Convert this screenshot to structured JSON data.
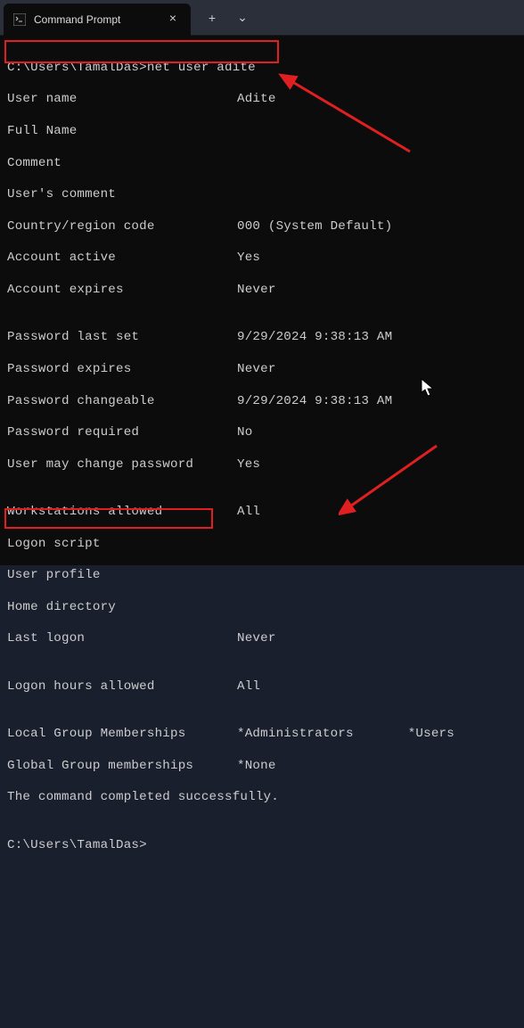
{
  "tab": {
    "title": "Command Prompt",
    "close_glyph": "×",
    "new_glyph": "+",
    "dropdown_glyph": "⌄"
  },
  "prompt_line": "C:\\Users\\TamalDas>net user adite",
  "blank": "",
  "info": {
    "user_name_l": "User name",
    "user_name_v": "Adite",
    "full_name_l": "Full Name",
    "full_name_v": "",
    "comment_l": "Comment",
    "comment_v": "",
    "users_comment_l": "User's comment",
    "users_comment_v": "",
    "country_l": "Country/region code",
    "country_v": "000 (System Default)",
    "acct_active_l": "Account active",
    "acct_active_v": "Yes",
    "acct_expires_l": "Account expires",
    "acct_expires_v": "Never",
    "pwd_last_set_l": "Password last set",
    "pwd_last_set_v": "9/29/2024 9:38:13 AM",
    "pwd_expires_l": "Password expires",
    "pwd_expires_v": "Never",
    "pwd_change_l": "Password changeable",
    "pwd_change_v": "9/29/2024 9:38:13 AM",
    "pwd_req_l": "Password required",
    "pwd_req_v": "No",
    "pwd_may_l": "User may change password",
    "pwd_may_v": "Yes",
    "ws_l": "Workstations allowed",
    "ws_v": "All",
    "logon_script_l": "Logon script",
    "logon_script_v": "",
    "profile_l": "User profile",
    "profile_v": "",
    "home_l": "Home directory",
    "home_v": "",
    "last_logon_l": "Last logon",
    "last_logon_v": "Never",
    "hours_l": "Logon hours allowed",
    "hours_v": "All",
    "local_grp_l": "Local Group Memberships",
    "local_grp_v": "*Administrators       *Users",
    "global_grp_l": "Global Group memberships",
    "global_grp_v": "*None",
    "done": "The command completed successfully."
  },
  "prompt2": "C:\\Users\\TamalDas>"
}
